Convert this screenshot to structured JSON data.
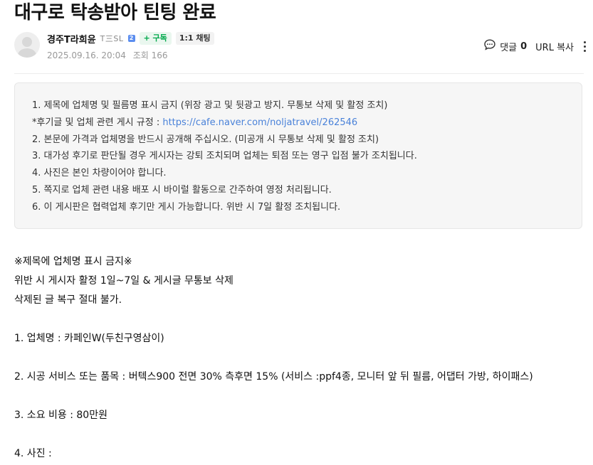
{
  "post": {
    "title": "대구로 탁송받아 틴팅 완료"
  },
  "author": {
    "name": "경주T라희윤",
    "level": "T三SL",
    "level_badge": "2",
    "follow_label": "+ 구독",
    "chat_label": "1:1 채팅",
    "date": "2025.09.16. 20:04",
    "views_label": "조회 166"
  },
  "actions": {
    "comment_label": "댓글",
    "comment_count": "0",
    "url_copy_label": "URL 복사"
  },
  "notice": {
    "line1": "1. 제목에 업체명 및 필름명 표시 금지 (위장 광고 및 뒷광고 방지. 무통보 삭제 및 활정 조치)",
    "line2_prefix": "*후기글 및 업체 관련 게시 규정 : ",
    "line2_link": "https://cafe.naver.com/noljatravel/262546",
    "line3": "2. 본문에 가격과 업체명을 반드시 공개해 주십시오. (미공개 시 무통보 삭제 및 활정 조치)",
    "line4": "3. 대가성 후기로 판단될 경우 게시자는 강퇴 조치되며 업체는 퇴점 또는 영구 입점 불가 조치됩니다.",
    "line5": "4. 사진은 본인 차량이어야 합니다.",
    "line6": "5. 쪽지로 업체 관련 내용 배포 시 바이럴 활동으로 간주하여 영정 처리됩니다.",
    "line7": "6. 이 게시판은 협력업체 후기만 게시 가능합니다. 위반 시 7일 활정 조치됩니다."
  },
  "content": {
    "line1": "※제목에 업체명 표시 금지※",
    "line2": "위반 시 게시자 활정 1일~7일 & 게시글 무통보 삭제",
    "line3": "삭제된 글 복구 절대 불가.",
    "line4": "1. 업체명 :  카페인W(두친구영삼이)",
    "line5": "2. 시공 서비스 또는 품목 :  버텍스900 전면 30% 측후면 15% (서비스 :ppf4종, 모니터 앞 뒤 필름, 어댑터 가방, 하이패스)",
    "line6": "3. 소요 비용 : 80만원",
    "line7": "4. 사진 :"
  },
  "icons": {
    "comment": "speech-bubble-icon",
    "more": "kebab-menu-icon",
    "avatar": "default-profile-avatar"
  }
}
